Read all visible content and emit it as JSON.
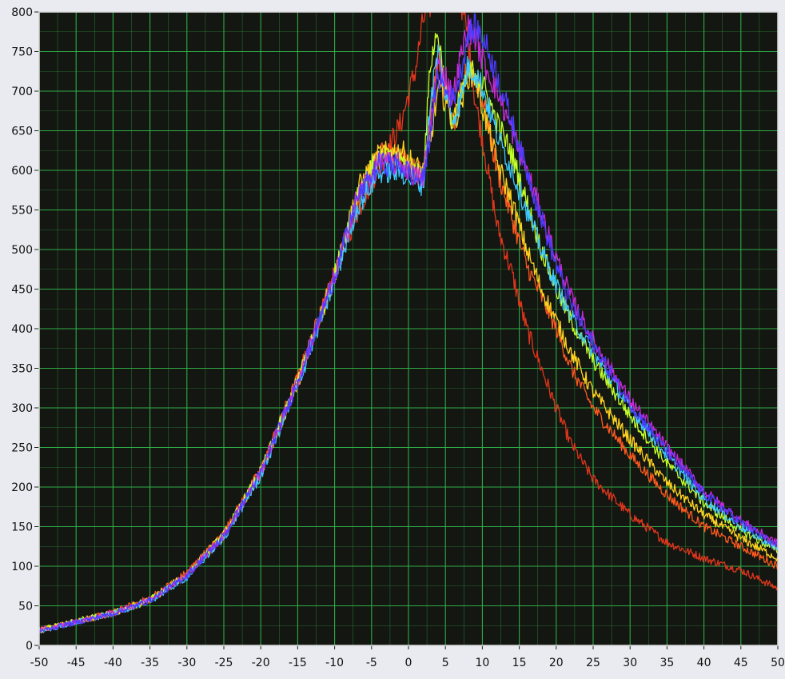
{
  "chart_data": {
    "type": "line",
    "title": "",
    "xlabel": "",
    "ylabel": "",
    "xlim": [
      -50,
      50
    ],
    "ylim": [
      0,
      800
    ],
    "x_ticks": [
      -50,
      -45,
      -40,
      -35,
      -30,
      -25,
      -20,
      -15,
      -10,
      -5,
      0,
      5,
      10,
      15,
      20,
      25,
      30,
      35,
      40,
      45,
      50
    ],
    "y_ticks": [
      0,
      50,
      100,
      150,
      200,
      250,
      300,
      350,
      400,
      450,
      500,
      550,
      600,
      650,
      700,
      750,
      800
    ],
    "x_tick_labels": [
      "-50",
      "-45",
      "-40",
      "-35",
      "-30",
      "-25",
      "-20",
      "-15",
      "-10",
      "-5",
      "0",
      "5",
      "10",
      "15",
      "20",
      "25",
      "30",
      "35",
      "40",
      "45",
      "50"
    ],
    "y_tick_labels": [
      "0",
      "50",
      "100",
      "150",
      "200",
      "250",
      "300",
      "350",
      "400",
      "450",
      "500",
      "550",
      "600",
      "650",
      "700",
      "750",
      "800"
    ],
    "grid": true,
    "legend": "none",
    "colors": {
      "plot_background": "#141611",
      "grid": "#2fb54a",
      "frame": "#d8d8d8"
    },
    "series": [
      {
        "color": "#e0361c",
        "x": [
          -50,
          -45,
          -40,
          -35,
          -30,
          -25,
          -20,
          -15,
          -10,
          -7,
          -4,
          -1,
          1,
          2,
          3,
          4,
          5,
          6,
          7,
          8,
          9,
          10,
          12,
          14,
          16,
          18,
          20,
          22,
          25,
          30,
          35,
          40,
          45,
          50
        ],
        "y": [
          20,
          30,
          40,
          58,
          90,
          140,
          220,
          335,
          470,
          545,
          605,
          660,
          730,
          790,
          810,
          840,
          860,
          850,
          820,
          770,
          690,
          640,
          530,
          470,
          400,
          350,
          300,
          255,
          210,
          165,
          130,
          110,
          95,
          72
        ]
      },
      {
        "color": "#ff5a1f",
        "x": [
          -50,
          -45,
          -40,
          -35,
          -30,
          -25,
          -20,
          -15,
          -10,
          -7,
          -4,
          -1,
          1,
          2,
          3,
          4,
          5,
          6,
          7,
          8,
          9,
          10,
          12,
          14,
          16,
          18,
          20,
          22,
          25,
          30,
          35,
          40,
          45,
          50
        ],
        "y": [
          18,
          30,
          42,
          60,
          92,
          142,
          222,
          338,
          470,
          560,
          622,
          620,
          598,
          600,
          680,
          745,
          700,
          655,
          690,
          730,
          720,
          690,
          600,
          540,
          480,
          440,
          400,
          350,
          300,
          240,
          190,
          150,
          125,
          100
        ]
      },
      {
        "color": "#ffd21f",
        "x": [
          -50,
          -45,
          -40,
          -35,
          -30,
          -25,
          -20,
          -15,
          -10,
          -7,
          -4,
          -1,
          1,
          2,
          3,
          4,
          5,
          6,
          7,
          8,
          9,
          10,
          12,
          14,
          16,
          18,
          20,
          22,
          25,
          30,
          35,
          40,
          45,
          50
        ],
        "y": [
          19,
          30,
          40,
          57,
          88,
          138,
          218,
          332,
          465,
          575,
          620,
          625,
          605,
          598,
          640,
          700,
          690,
          660,
          680,
          720,
          720,
          680,
          610,
          560,
          500,
          450,
          410,
          370,
          320,
          260,
          205,
          165,
          135,
          110
        ]
      },
      {
        "color": "#c4ff2a",
        "x": [
          -50,
          -45,
          -40,
          -35,
          -30,
          -25,
          -20,
          -15,
          -10,
          -7,
          -4,
          -1,
          1,
          2,
          3,
          4,
          5,
          6,
          7,
          8,
          9,
          10,
          12,
          14,
          16,
          18,
          20,
          22,
          25,
          30,
          35,
          40,
          45,
          50
        ],
        "y": [
          20,
          31,
          41,
          58,
          90,
          140,
          220,
          335,
          468,
          570,
          615,
          612,
          598,
          595,
          740,
          775,
          700,
          660,
          690,
          720,
          725,
          710,
          660,
          620,
          560,
          500,
          450,
          410,
          360,
          290,
          230,
          180,
          145,
          120
        ]
      },
      {
        "color": "#3ec8ff",
        "x": [
          -50,
          -45,
          -40,
          -35,
          -30,
          -25,
          -20,
          -15,
          -10,
          -7,
          -4,
          -1,
          1,
          2,
          3,
          4,
          5,
          6,
          7,
          8,
          9,
          10,
          12,
          14,
          16,
          18,
          20,
          22,
          25,
          30,
          35,
          40,
          45,
          50
        ],
        "y": [
          18,
          29,
          40,
          56,
          86,
          136,
          214,
          328,
          460,
          552,
          598,
          598,
          585,
          582,
          690,
          750,
          700,
          665,
          685,
          730,
          725,
          705,
          645,
          600,
          550,
          500,
          455,
          415,
          370,
          300,
          240,
          185,
          150,
          122
        ]
      },
      {
        "color": "#c82bd9",
        "x": [
          -50,
          -45,
          -40,
          -35,
          -30,
          -25,
          -20,
          -15,
          -10,
          -7,
          -4,
          -1,
          1,
          2,
          3,
          4,
          5,
          6,
          7,
          8,
          9,
          10,
          12,
          14,
          16,
          18,
          20,
          22,
          25,
          30,
          35,
          40,
          45,
          50
        ],
        "y": [
          19,
          30,
          41,
          58,
          89,
          139,
          219,
          334,
          466,
          566,
          610,
          608,
          592,
          590,
          660,
          730,
          720,
          690,
          740,
          780,
          770,
          740,
          700,
          650,
          600,
          545,
          490,
          440,
          385,
          310,
          250,
          195,
          158,
          128
        ]
      },
      {
        "color": "#4a3cff",
        "x": [
          -50,
          -45,
          -40,
          -35,
          -30,
          -25,
          -20,
          -15,
          -10,
          -7,
          -4,
          -1,
          1,
          2,
          3,
          4,
          5,
          6,
          7,
          8,
          9,
          10,
          12,
          14,
          16,
          18,
          20,
          22,
          25,
          30,
          35,
          40,
          45,
          50
        ],
        "y": [
          18,
          29,
          40,
          57,
          88,
          138,
          218,
          333,
          466,
          563,
          608,
          606,
          590,
          588,
          650,
          720,
          700,
          690,
          720,
          770,
          780,
          770,
          720,
          660,
          600,
          540,
          480,
          430,
          380,
          305,
          245,
          192,
          155,
          125
        ]
      }
    ]
  }
}
